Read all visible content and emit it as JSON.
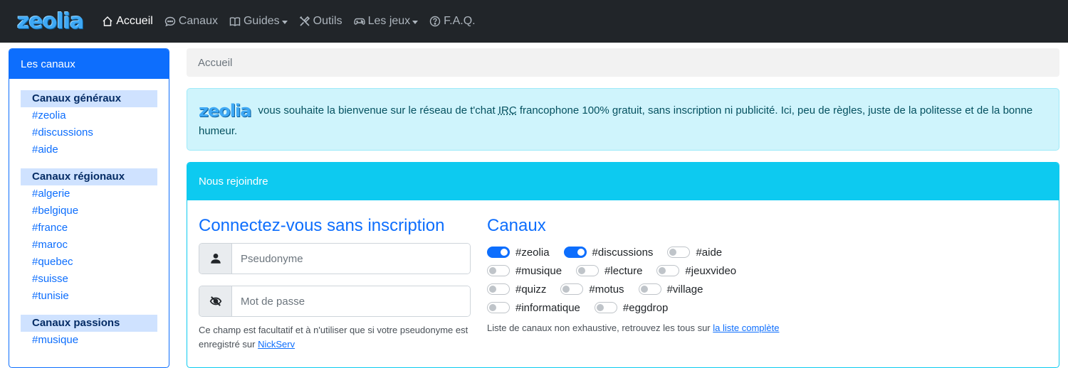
{
  "brand": "zeolia",
  "nav": {
    "items": [
      {
        "label": "Accueil",
        "icon": "home-icon",
        "active": true
      },
      {
        "label": "Canaux",
        "icon": "chat-icon"
      },
      {
        "label": "Guides",
        "icon": "book-icon",
        "dropdown": true
      },
      {
        "label": "Outils",
        "icon": "tools-icon"
      },
      {
        "label": "Les jeux",
        "icon": "gamepad-icon",
        "dropdown": true
      },
      {
        "label": "F.A.Q.",
        "icon": "question-icon"
      }
    ]
  },
  "sidebar": {
    "title": "Les canaux",
    "groups": [
      {
        "title": "Canaux généraux",
        "links": [
          "#zeolia",
          "#discussions",
          "#aide"
        ]
      },
      {
        "title": "Canaux régionaux",
        "links": [
          "#algerie",
          "#belgique",
          "#france",
          "#maroc",
          "#quebec",
          "#suisse",
          "#tunisie"
        ]
      },
      {
        "title": "Canaux passions",
        "links": [
          "#musique"
        ]
      }
    ]
  },
  "breadcrumb": "Accueil",
  "welcome": {
    "logo": "zeolia",
    "text_before": " vous souhaite la bienvenue sur le réseau de t'chat ",
    "abbr": "IRC",
    "text_after": " francophone 100% gratuit, sans inscription ni publicité. Ici, peu de règles, juste de la politesse et de la bonne humeur."
  },
  "join": {
    "header": "Nous rejoindre",
    "connect_title": "Connectez-vous sans inscription",
    "pseudo_placeholder": "Pseudonyme",
    "password_placeholder": "Mot de passe",
    "help_text": "Ce champ est facultatif et à n'utiliser que si votre pseudonyme est enregistré sur ",
    "help_link": "NickServ",
    "channels_title": "Canaux",
    "channel_rows": [
      [
        {
          "name": "#zeolia",
          "on": true
        },
        {
          "name": "#discussions",
          "on": true
        },
        {
          "name": "#aide",
          "on": false
        }
      ],
      [
        {
          "name": "#musique",
          "on": false
        },
        {
          "name": "#lecture",
          "on": false
        },
        {
          "name": "#jeuxvideo",
          "on": false
        }
      ],
      [
        {
          "name": "#quizz",
          "on": false
        },
        {
          "name": "#motus",
          "on": false
        },
        {
          "name": "#village",
          "on": false
        }
      ],
      [
        {
          "name": "#informatique",
          "on": false
        },
        {
          "name": "#eggdrop",
          "on": false
        }
      ]
    ],
    "channels_help": "Liste de canaux non exhaustive, retrouvez les tous sur ",
    "channels_help_link": "la liste complète"
  },
  "colors": {
    "primary": "#0d6efd",
    "info": "#0dcaf0",
    "navbar": "#212529"
  }
}
